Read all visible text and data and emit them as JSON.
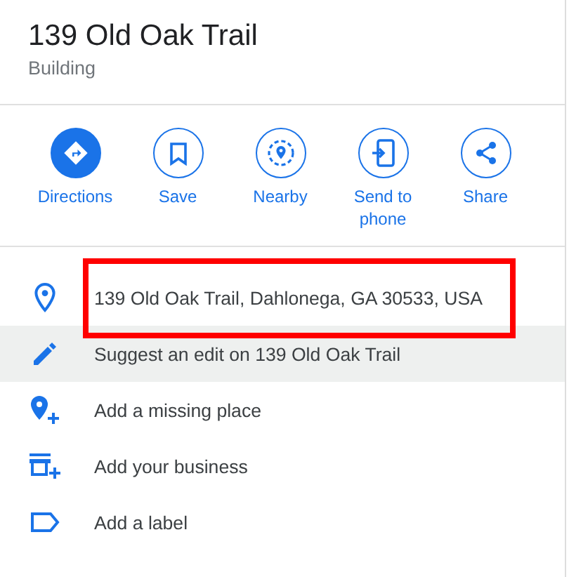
{
  "place": {
    "title": "139 Old Oak Trail",
    "category": "Building"
  },
  "actions": [
    {
      "kind": "directions",
      "label": "Directions",
      "filled": true
    },
    {
      "kind": "save",
      "label": "Save",
      "filled": false
    },
    {
      "kind": "nearby",
      "label": "Nearby",
      "filled": false
    },
    {
      "kind": "send",
      "label": "Send to phone",
      "filled": false
    },
    {
      "kind": "share",
      "label": "Share",
      "filled": false
    }
  ],
  "rows": [
    {
      "kind": "address",
      "text": "139 Old Oak Trail, Dahlonega, GA 30533, USA",
      "hovered": false,
      "annotated": true
    },
    {
      "kind": "edit",
      "text": "Suggest an edit on 139 Old Oak Trail",
      "hovered": true,
      "annotated": false
    },
    {
      "kind": "add-place",
      "text": "Add a missing place",
      "hovered": false,
      "annotated": false
    },
    {
      "kind": "add-business",
      "text": "Add your business",
      "hovered": false,
      "annotated": false
    },
    {
      "kind": "label",
      "text": "Add a label",
      "hovered": false,
      "annotated": false
    }
  ]
}
